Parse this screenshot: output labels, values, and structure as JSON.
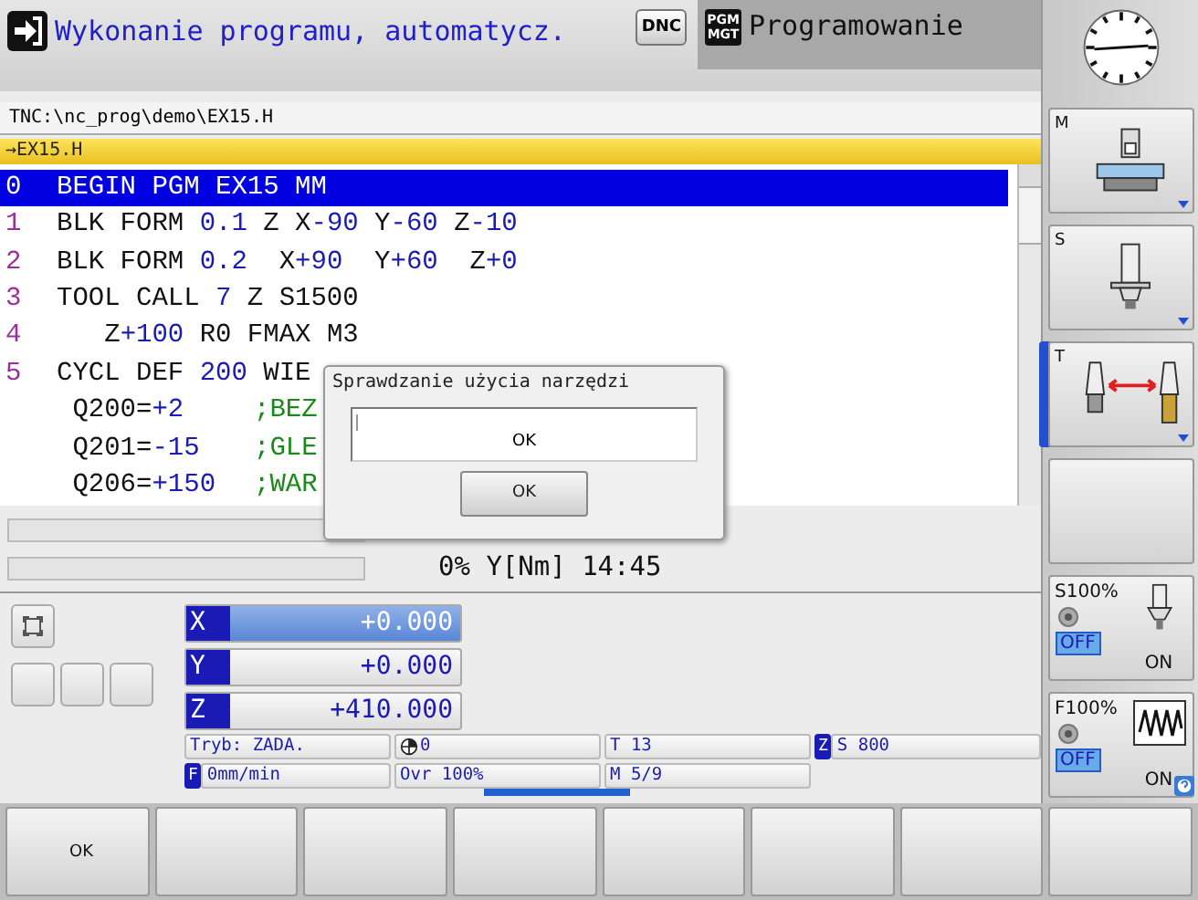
{
  "header": {
    "mode_title": "Wykonanie programu, automatycz.",
    "dnc_label": "DNC",
    "tab": {
      "icon_label": "PGM MGT",
      "label": "Programowanie",
      "selected": true
    }
  },
  "path": "TNC:\\nc_prog\\demo\\EX15.H",
  "file_tab": "→EX15.H",
  "program": [
    {
      "number": "0",
      "selected": true,
      "tokens": [
        {
          "t": "BEGIN PGM EX15 MM",
          "kind": "text"
        }
      ]
    },
    {
      "number": "1",
      "selected": false,
      "tokens": [
        {
          "t": "BLK FORM ",
          "kind": "text"
        },
        {
          "t": "0.1",
          "kind": "num"
        },
        {
          "t": " Z X",
          "kind": "text"
        },
        {
          "t": "-90",
          "kind": "num"
        },
        {
          "t": " Y",
          "kind": "text"
        },
        {
          "t": "-60",
          "kind": "num"
        },
        {
          "t": " Z",
          "kind": "text"
        },
        {
          "t": "-10",
          "kind": "num"
        }
      ]
    },
    {
      "number": "2",
      "selected": false,
      "tokens": [
        {
          "t": "BLK FORM ",
          "kind": "text"
        },
        {
          "t": "0.2",
          "kind": "num"
        },
        {
          "t": "  X",
          "kind": "text"
        },
        {
          "t": "+90",
          "kind": "num"
        },
        {
          "t": "  Y",
          "kind": "text"
        },
        {
          "t": "+60",
          "kind": "num"
        },
        {
          "t": "  Z",
          "kind": "text"
        },
        {
          "t": "+0",
          "kind": "num"
        }
      ]
    },
    {
      "number": "3",
      "selected": false,
      "tokens": [
        {
          "t": "TOOL CALL ",
          "kind": "text"
        },
        {
          "t": "7",
          "kind": "num"
        },
        {
          "t": " Z S1500",
          "kind": "text"
        }
      ]
    },
    {
      "number": "4",
      "selected": false,
      "tokens": [
        {
          "t": "   Z",
          "kind": "text"
        },
        {
          "t": "+100",
          "kind": "num"
        },
        {
          "t": " R0 FMAX M3",
          "kind": "text"
        }
      ]
    },
    {
      "number": "5",
      "selected": false,
      "tokens": [
        {
          "t": "CYCL DEF ",
          "kind": "text"
        },
        {
          "t": "200",
          "kind": "num"
        },
        {
          "t": " WIE",
          "kind": "text"
        }
      ]
    },
    {
      "selected": false,
      "tokens": [
        {
          "t": " Q200=",
          "kind": "text"
        },
        {
          "t": "+2",
          "kind": "num"
        },
        {
          "t": ";BEZ",
          "kind": "comment"
        }
      ]
    },
    {
      "selected": false,
      "tokens": [
        {
          "t": " Q201=",
          "kind": "text"
        },
        {
          "t": "-15",
          "kind": "num"
        },
        {
          "t": ";GLE",
          "kind": "comment"
        }
      ]
    },
    {
      "selected": false,
      "tokens": [
        {
          "t": " Q206=",
          "kind": "text"
        },
        {
          "t": "+150",
          "kind": "num"
        },
        {
          "t": ";WAR",
          "kind": "comment"
        }
      ]
    }
  ],
  "status": {
    "readout": "0% Y[Nm] 14:45"
  },
  "dialog": {
    "title": "Sprawdzanie użycia narzędzi",
    "field_text": "OK",
    "button": "OK"
  },
  "positions": [
    {
      "axis": "X",
      "value": "+0.000",
      "selected": true
    },
    {
      "axis": "Y",
      "value": "+0.000",
      "selected": false
    },
    {
      "axis": "Z",
      "value": "+410.000",
      "selected": false
    }
  ],
  "status_fields": [
    [
      {
        "text": "Tryb: ZADA.",
        "kind": "plain"
      },
      {
        "text": "0",
        "kind": "datum"
      },
      {
        "text": "T 13",
        "kind": "plain"
      },
      {
        "badge": "Z",
        "text": "S 800",
        "kind": "badge"
      }
    ],
    [
      {
        "badge": "F",
        "text": "0mm/min",
        "kind": "badge"
      },
      {
        "text": "Ovr 100%",
        "kind": "plain"
      },
      {
        "text": "M 5/9",
        "kind": "plain"
      }
    ]
  ],
  "sidebar": [
    {
      "kind": "machine",
      "label": "M",
      "selected": false
    },
    {
      "kind": "spindle",
      "label": "S",
      "selected": false
    },
    {
      "kind": "tool-change",
      "label": "T",
      "selected": true
    },
    {
      "kind": "blank",
      "selected": false
    },
    {
      "kind": "spindle-override",
      "label": "S100%",
      "options": [
        {
          "label": "OFF",
          "selected": true
        },
        {
          "label": "ON",
          "selected": false
        }
      ]
    },
    {
      "kind": "feed-override",
      "label": "F100%",
      "options": [
        {
          "label": "OFF",
          "selected": true
        },
        {
          "label": "ON",
          "selected": false
        }
      ]
    }
  ],
  "softkeys": [
    {
      "kind": "labelled",
      "label": "OK"
    },
    {
      "kind": "blank"
    },
    {
      "kind": "blank"
    },
    {
      "kind": "blank"
    },
    {
      "kind": "blank"
    },
    {
      "kind": "blank"
    },
    {
      "kind": "blank"
    },
    {
      "kind": "blank"
    }
  ]
}
